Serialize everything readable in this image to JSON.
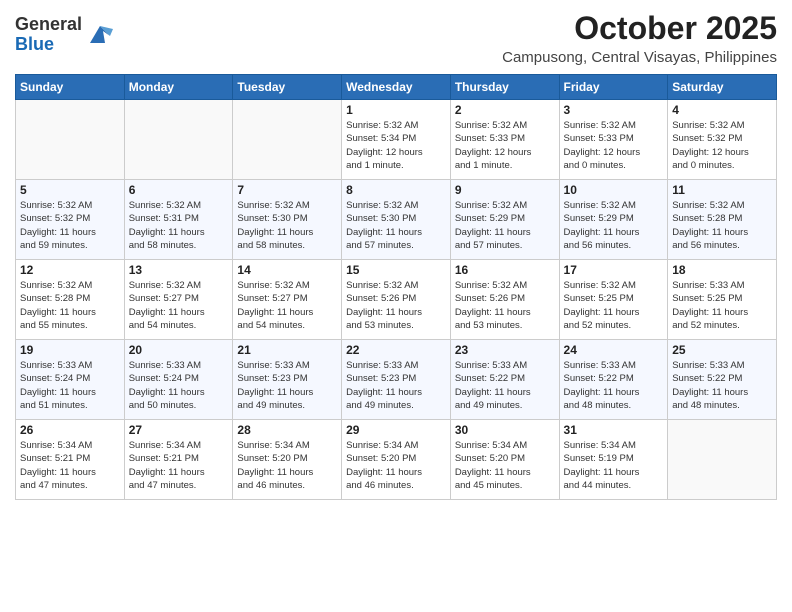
{
  "header": {
    "logo_line1": "General",
    "logo_line2": "Blue",
    "month": "October 2025",
    "location": "Campusong, Central Visayas, Philippines"
  },
  "weekdays": [
    "Sunday",
    "Monday",
    "Tuesday",
    "Wednesday",
    "Thursday",
    "Friday",
    "Saturday"
  ],
  "weeks": [
    [
      {
        "day": "",
        "info": ""
      },
      {
        "day": "",
        "info": ""
      },
      {
        "day": "",
        "info": ""
      },
      {
        "day": "1",
        "info": "Sunrise: 5:32 AM\nSunset: 5:34 PM\nDaylight: 12 hours\nand 1 minute."
      },
      {
        "day": "2",
        "info": "Sunrise: 5:32 AM\nSunset: 5:33 PM\nDaylight: 12 hours\nand 1 minute."
      },
      {
        "day": "3",
        "info": "Sunrise: 5:32 AM\nSunset: 5:33 PM\nDaylight: 12 hours\nand 0 minutes."
      },
      {
        "day": "4",
        "info": "Sunrise: 5:32 AM\nSunset: 5:32 PM\nDaylight: 12 hours\nand 0 minutes."
      }
    ],
    [
      {
        "day": "5",
        "info": "Sunrise: 5:32 AM\nSunset: 5:32 PM\nDaylight: 11 hours\nand 59 minutes."
      },
      {
        "day": "6",
        "info": "Sunrise: 5:32 AM\nSunset: 5:31 PM\nDaylight: 11 hours\nand 58 minutes."
      },
      {
        "day": "7",
        "info": "Sunrise: 5:32 AM\nSunset: 5:30 PM\nDaylight: 11 hours\nand 58 minutes."
      },
      {
        "day": "8",
        "info": "Sunrise: 5:32 AM\nSunset: 5:30 PM\nDaylight: 11 hours\nand 57 minutes."
      },
      {
        "day": "9",
        "info": "Sunrise: 5:32 AM\nSunset: 5:29 PM\nDaylight: 11 hours\nand 57 minutes."
      },
      {
        "day": "10",
        "info": "Sunrise: 5:32 AM\nSunset: 5:29 PM\nDaylight: 11 hours\nand 56 minutes."
      },
      {
        "day": "11",
        "info": "Sunrise: 5:32 AM\nSunset: 5:28 PM\nDaylight: 11 hours\nand 56 minutes."
      }
    ],
    [
      {
        "day": "12",
        "info": "Sunrise: 5:32 AM\nSunset: 5:28 PM\nDaylight: 11 hours\nand 55 minutes."
      },
      {
        "day": "13",
        "info": "Sunrise: 5:32 AM\nSunset: 5:27 PM\nDaylight: 11 hours\nand 54 minutes."
      },
      {
        "day": "14",
        "info": "Sunrise: 5:32 AM\nSunset: 5:27 PM\nDaylight: 11 hours\nand 54 minutes."
      },
      {
        "day": "15",
        "info": "Sunrise: 5:32 AM\nSunset: 5:26 PM\nDaylight: 11 hours\nand 53 minutes."
      },
      {
        "day": "16",
        "info": "Sunrise: 5:32 AM\nSunset: 5:26 PM\nDaylight: 11 hours\nand 53 minutes."
      },
      {
        "day": "17",
        "info": "Sunrise: 5:32 AM\nSunset: 5:25 PM\nDaylight: 11 hours\nand 52 minutes."
      },
      {
        "day": "18",
        "info": "Sunrise: 5:33 AM\nSunset: 5:25 PM\nDaylight: 11 hours\nand 52 minutes."
      }
    ],
    [
      {
        "day": "19",
        "info": "Sunrise: 5:33 AM\nSunset: 5:24 PM\nDaylight: 11 hours\nand 51 minutes."
      },
      {
        "day": "20",
        "info": "Sunrise: 5:33 AM\nSunset: 5:24 PM\nDaylight: 11 hours\nand 50 minutes."
      },
      {
        "day": "21",
        "info": "Sunrise: 5:33 AM\nSunset: 5:23 PM\nDaylight: 11 hours\nand 49 minutes."
      },
      {
        "day": "22",
        "info": "Sunrise: 5:33 AM\nSunset: 5:23 PM\nDaylight: 11 hours\nand 49 minutes."
      },
      {
        "day": "23",
        "info": "Sunrise: 5:33 AM\nSunset: 5:22 PM\nDaylight: 11 hours\nand 49 minutes."
      },
      {
        "day": "24",
        "info": "Sunrise: 5:33 AM\nSunset: 5:22 PM\nDaylight: 11 hours\nand 48 minutes."
      },
      {
        "day": "25",
        "info": "Sunrise: 5:33 AM\nSunset: 5:22 PM\nDaylight: 11 hours\nand 48 minutes."
      }
    ],
    [
      {
        "day": "26",
        "info": "Sunrise: 5:34 AM\nSunset: 5:21 PM\nDaylight: 11 hours\nand 47 minutes."
      },
      {
        "day": "27",
        "info": "Sunrise: 5:34 AM\nSunset: 5:21 PM\nDaylight: 11 hours\nand 47 minutes."
      },
      {
        "day": "28",
        "info": "Sunrise: 5:34 AM\nSunset: 5:20 PM\nDaylight: 11 hours\nand 46 minutes."
      },
      {
        "day": "29",
        "info": "Sunrise: 5:34 AM\nSunset: 5:20 PM\nDaylight: 11 hours\nand 46 minutes."
      },
      {
        "day": "30",
        "info": "Sunrise: 5:34 AM\nSunset: 5:20 PM\nDaylight: 11 hours\nand 45 minutes."
      },
      {
        "day": "31",
        "info": "Sunrise: 5:34 AM\nSunset: 5:19 PM\nDaylight: 11 hours\nand 44 minutes."
      },
      {
        "day": "",
        "info": ""
      }
    ]
  ]
}
